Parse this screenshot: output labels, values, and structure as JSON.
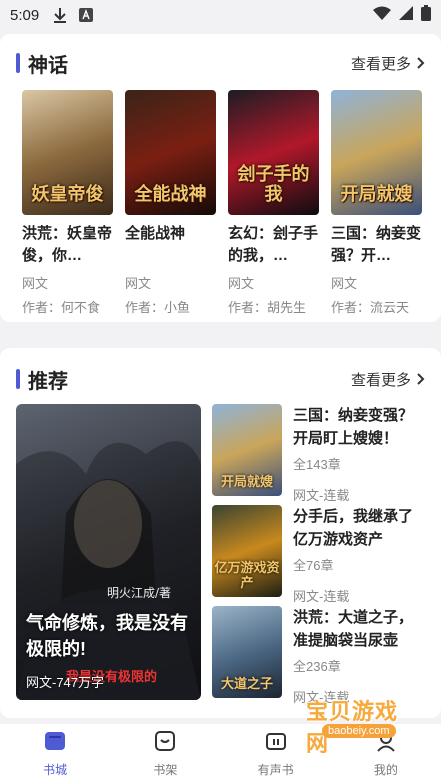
{
  "status": {
    "time": "5:09"
  },
  "mythology": {
    "title": "神话",
    "more": "查看更多",
    "books": [
      {
        "name": "洪荒：妖皇帝俊，你…",
        "category": "网文",
        "author": "作者：何不食",
        "cover_text": "妖皇帝俊",
        "cover_colors": [
          "#d9c7a4",
          "#8c6a3e",
          "#3b2a1a"
        ]
      },
      {
        "name": "全能战神",
        "category": "网文",
        "author": "作者：小鱼",
        "cover_text": "全能战神",
        "cover_colors": [
          "#3a2418",
          "#7a1f12",
          "#140a08"
        ]
      },
      {
        "name": "玄幻：刽子手的我，…",
        "category": "网文",
        "author": "作者：胡先生",
        "cover_text": "刽子手的我",
        "cover_colors": [
          "#1c1d24",
          "#b0182a",
          "#0c0c10"
        ]
      },
      {
        "name": "三国：纳妾变强？开…",
        "category": "网文",
        "author": "作者：流云天",
        "cover_text": "开局就嫂",
        "cover_colors": [
          "#8fb3d8",
          "#c9a55a",
          "#3a4f7a"
        ]
      }
    ]
  },
  "recommend": {
    "title": "推荐",
    "more": "查看更多",
    "featured": {
      "title": "气命修炼，我是没有极限的!",
      "meta": "网文-747万字",
      "author_text": "明火江成/著",
      "sub_text": "我是没有极限的",
      "cover_colors": [
        "#5d6470",
        "#2a2c33",
        "#14151a"
      ]
    },
    "list": [
      {
        "name": "三国：纳妾变强？开局盯上嫂嫂！",
        "count": "全143章",
        "category": "网文-连载",
        "cover_text": "开局就嫂",
        "cover_colors": [
          "#8fb3d8",
          "#c9a55a",
          "#3a4f7a"
        ]
      },
      {
        "name": "分手后，我继承了亿万游戏资产",
        "count": "全76章",
        "category": "网文-连载",
        "cover_text": "亿万游戏资产",
        "cover_colors": [
          "#3a4432",
          "#c8891e",
          "#1c1e14"
        ]
      },
      {
        "name": "洪荒：大道之子，准提脑袋当尿壶",
        "count": "全236章",
        "category": "网文-连载",
        "cover_text": "大道之子",
        "cover_colors": [
          "#9bb4c8",
          "#4e6a86",
          "#1b2533"
        ]
      }
    ]
  },
  "tabs": [
    {
      "label": "书城",
      "icon": "bookstore-icon",
      "active": true
    },
    {
      "label": "书架",
      "icon": "bookshelf-icon",
      "active": false
    },
    {
      "label": "有声书",
      "icon": "audiobook-icon",
      "active": false
    },
    {
      "label": "我的",
      "icon": "profile-icon",
      "active": false
    }
  ],
  "watermark": {
    "text": "宝贝游戏网",
    "url": "baobeiy.com"
  },
  "colors": {
    "accent": "#4f5bd5",
    "muted": "#888888"
  }
}
